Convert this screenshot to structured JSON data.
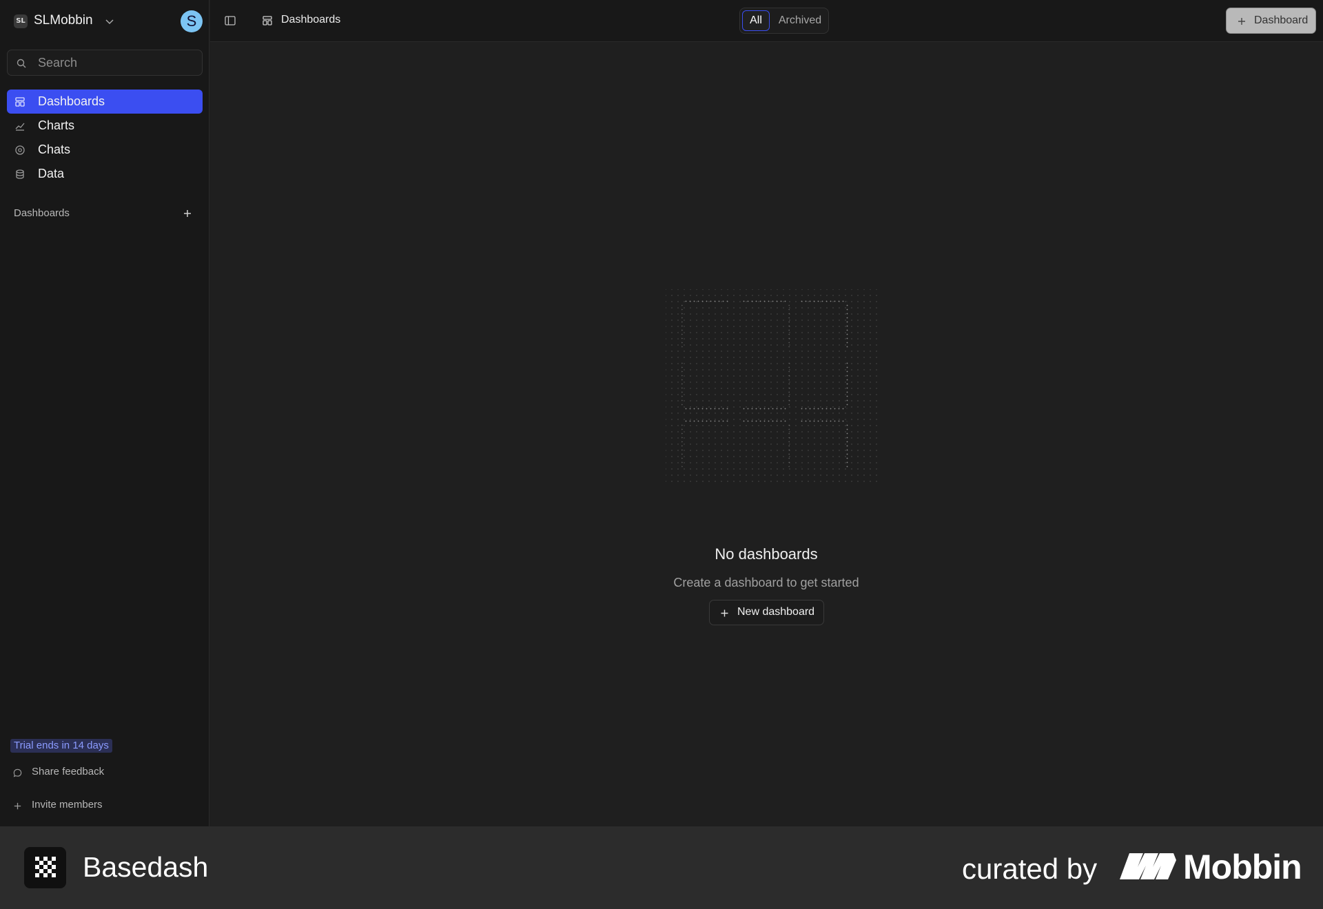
{
  "workspace": {
    "badge": "SL",
    "name": "SLMobbin",
    "avatar_letter": "S"
  },
  "search": {
    "placeholder": "Search"
  },
  "nav": {
    "items": [
      {
        "label": "Dashboards",
        "icon": "dashboard-icon",
        "active": true
      },
      {
        "label": "Charts",
        "icon": "chart-line-icon",
        "active": false
      },
      {
        "label": "Chats",
        "icon": "chat-icon",
        "active": false
      },
      {
        "label": "Data",
        "icon": "database-icon",
        "active": false
      }
    ]
  },
  "section": {
    "title": "Dashboards"
  },
  "footer": {
    "trial": "Trial ends in 14 days",
    "feedback": "Share feedback",
    "invite": "Invite members"
  },
  "topbar": {
    "breadcrumb": "Dashboards",
    "filter_all": "All",
    "filter_archived": "Archived",
    "add_button": "Dashboard"
  },
  "empty_state": {
    "title": "No dashboards",
    "subtitle": "Create a dashboard to get started",
    "button": "New dashboard"
  },
  "branding": {
    "app_name": "Basedash",
    "curated_by": "curated by",
    "curator": "Mobbin"
  },
  "colors": {
    "accent": "#3b4ef1",
    "background": "#1f1f1f",
    "sidebar": "#181818",
    "trial_text": "#8b9bff",
    "avatar": "#7cc4f3"
  }
}
